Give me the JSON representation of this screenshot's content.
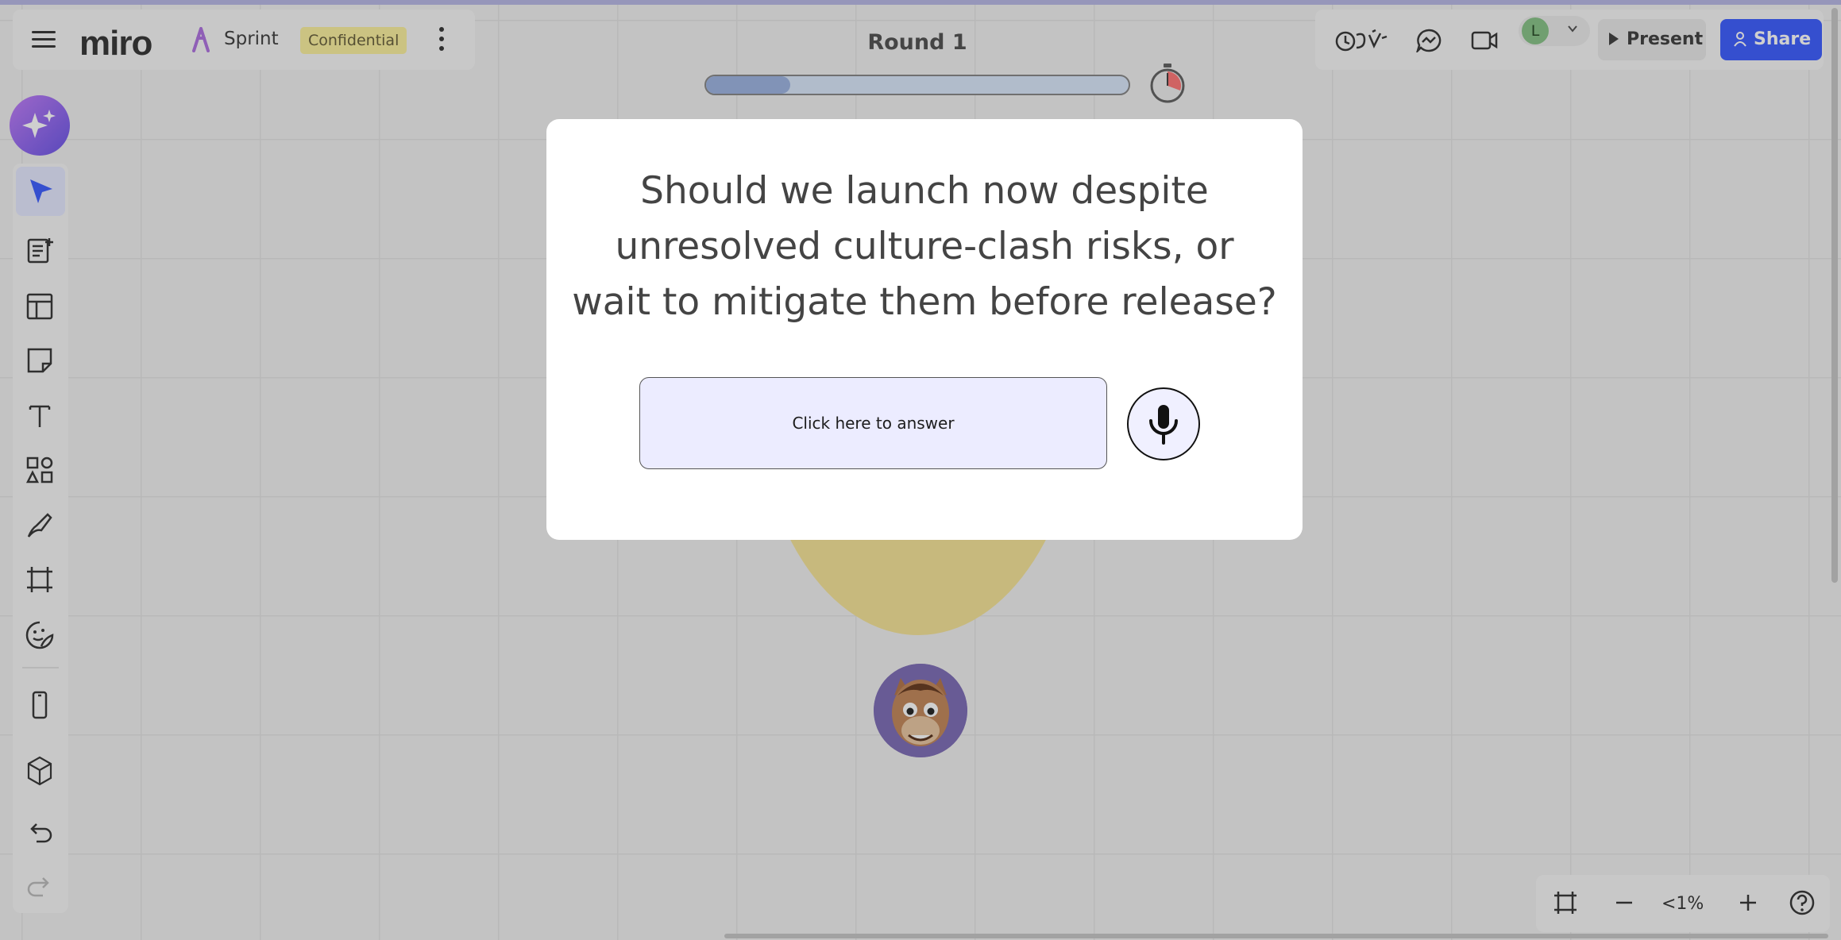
{
  "board": {
    "logo": "miro",
    "name": "Sprint",
    "badge": "Confidential"
  },
  "round": {
    "title": "Round 1",
    "progress_fraction": 0.2
  },
  "toolbar_right": {
    "user_initial": "L",
    "present_label": "Present",
    "share_label": "Share"
  },
  "zoom": {
    "value": "<1%"
  },
  "modal": {
    "question": "Should we launch now despite unresolved culture-clash risks, or wait to mitigate them before release?",
    "answer_label": "Click here to answer"
  },
  "colors": {
    "accent": "#4262ff",
    "badge_bg": "#fbf0a0",
    "answer_bg": "#ececff",
    "progress_fill": "#9fb6e2"
  },
  "icons": {
    "menu": "hamburger-icon",
    "sprint": "sprint-icon",
    "more": "kebab-icon",
    "timer": "stopwatch-icon",
    "reactions": "reactions-icon",
    "comments": "chat-icon",
    "video": "video-icon",
    "mic": "microphone-icon"
  }
}
